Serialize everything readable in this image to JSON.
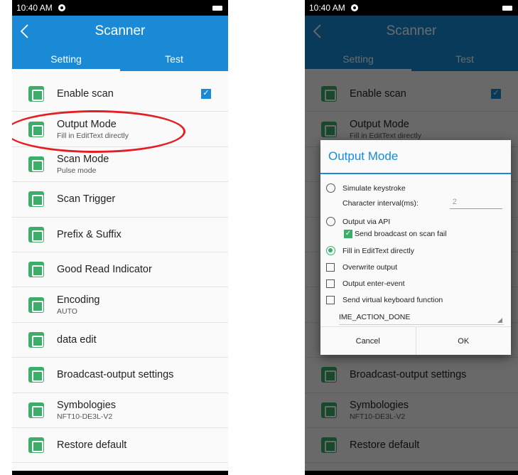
{
  "status_time": "10:40 AM",
  "app_title": "Scanner",
  "tabs": [
    "Setting",
    "Test"
  ],
  "colors": {
    "primary": "#1a8ad7",
    "icon_green": "#3cae6a",
    "highlight": "#e31e24"
  },
  "rows": [
    {
      "label": "Enable scan",
      "sub": "",
      "icon": "scan-icon"
    },
    {
      "label": "Output Mode",
      "sub": "Fill in EditText directly",
      "icon": "output-icon"
    },
    {
      "label": "Scan Mode",
      "sub": "Pulse mode",
      "icon": "barcode-icon"
    },
    {
      "label": "Scan Trigger",
      "sub": "",
      "icon": "trigger-icon"
    },
    {
      "label": "Prefix & Suffix",
      "sub": "",
      "icon": "prefix-icon"
    },
    {
      "label": "Good Read Indicator",
      "sub": "",
      "icon": "indicator-icon"
    },
    {
      "label": "Encoding",
      "sub": "AUTO",
      "icon": "encoding-icon"
    },
    {
      "label": "data edit",
      "sub": "",
      "icon": "edit-icon"
    },
    {
      "label": "Broadcast-output settings",
      "sub": "",
      "icon": "broadcast-icon"
    },
    {
      "label": "Symbologies",
      "sub": "NFT10-DE3L-V2",
      "icon": "symbologies-icon"
    },
    {
      "label": "Restore default",
      "sub": "",
      "icon": "restore-icon"
    }
  ],
  "enable_scan_checked": true,
  "dialog": {
    "title": "Output Mode",
    "simulate_keystroke": "Simulate keystroke",
    "char_interval_label": "Character interval(ms):",
    "char_interval_value": "2",
    "output_via_api": "Output via API",
    "send_broadcast": "Send broadcast on scan fail",
    "fill_edittext": "Fill in EditText directly",
    "overwrite_output": "Overwrite output",
    "output_enter_event": "Output enter-event",
    "send_virtual_keyboard": "Send virtual keyboard function",
    "ime_action": "IME_ACTION_DONE",
    "cancel": "Cancel",
    "ok": "OK"
  }
}
